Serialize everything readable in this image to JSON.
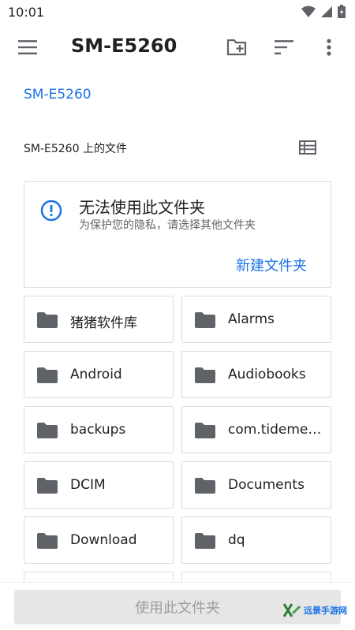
{
  "status_bar": {
    "time": "10:01"
  },
  "app_bar": {
    "title": "SM-E5260"
  },
  "breadcrumb": {
    "label": "SM-E5260"
  },
  "section": {
    "title": "SM-E5260 上的文件"
  },
  "warning": {
    "title": "无法使用此文件夹",
    "subtitle": "为保护您的隐私，请选择其他文件夹",
    "action_label": "新建文件夹"
  },
  "folders": [
    {
      "name": "猪猪软件库"
    },
    {
      "name": "Alarms"
    },
    {
      "name": "Android"
    },
    {
      "name": "Audiobooks"
    },
    {
      "name": "backups"
    },
    {
      "name": "com.tidemedia"
    },
    {
      "name": "DCIM"
    },
    {
      "name": "Documents"
    },
    {
      "name": "Download"
    },
    {
      "name": "dq"
    }
  ],
  "bottom": {
    "use_folder_label": "使用此文件夹"
  },
  "watermark": {
    "text": "远景手游网"
  },
  "colors": {
    "accent": "#1a73e8",
    "icon_gray": "#5f6368",
    "border": "#dadce0"
  }
}
